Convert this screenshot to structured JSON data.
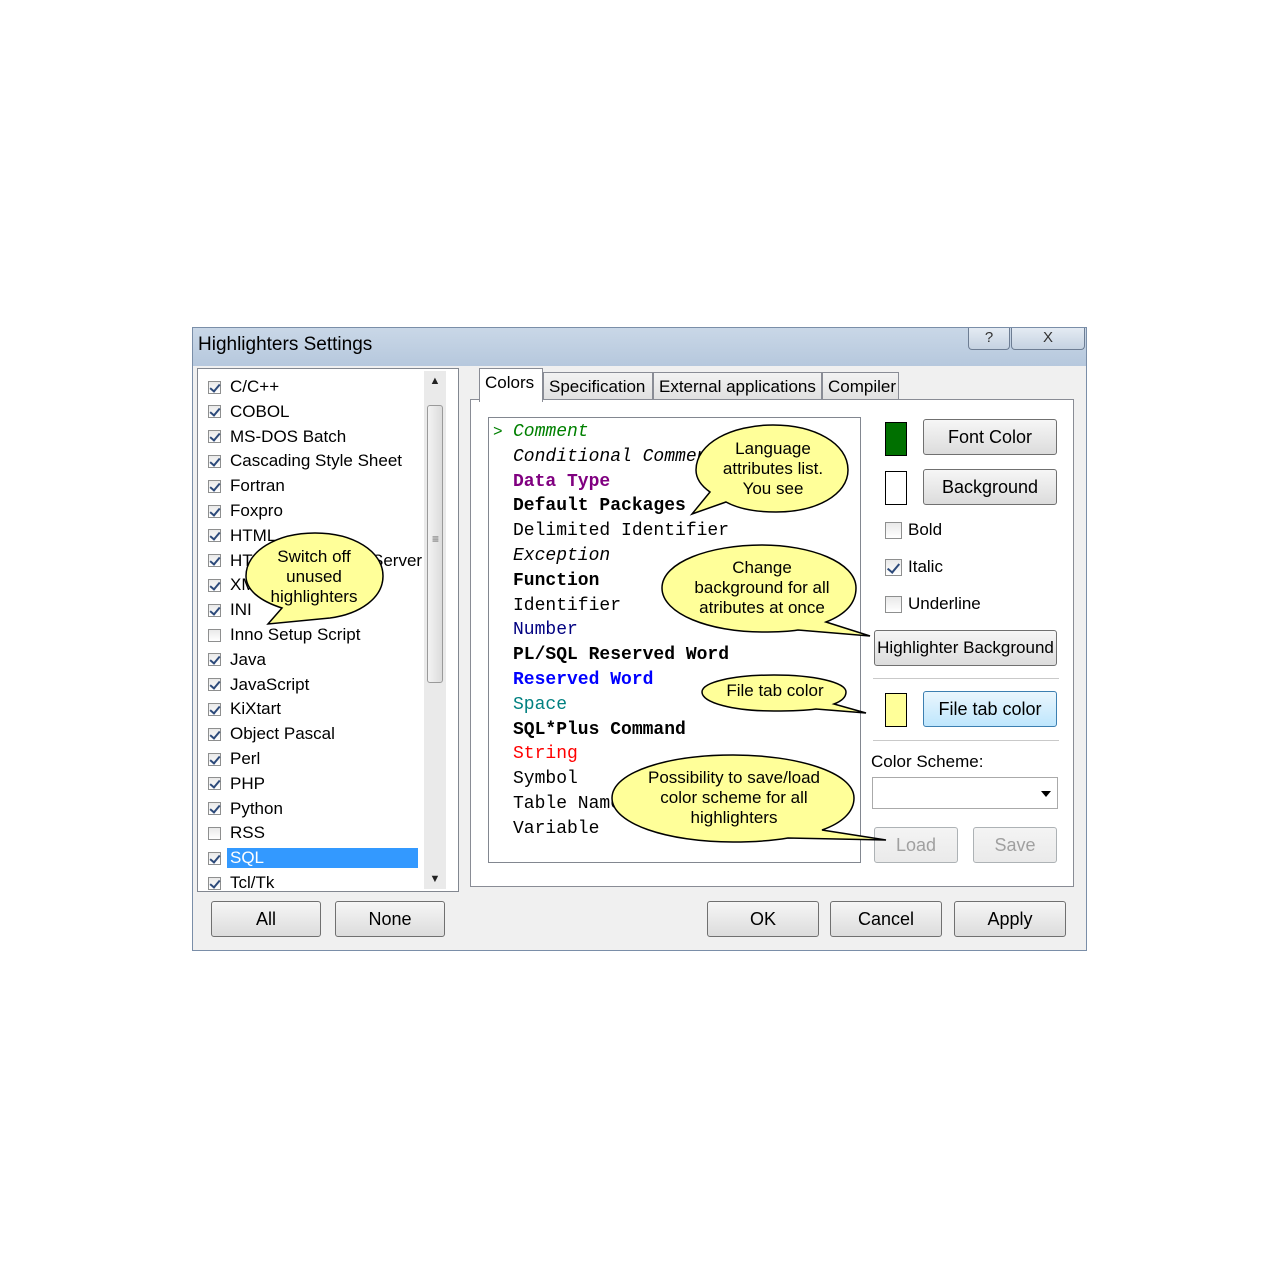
{
  "window": {
    "title": "Highlighters Settings",
    "help_label": "?",
    "close_label": "X"
  },
  "languages": [
    {
      "label": "C/C++",
      "checked": true
    },
    {
      "label": "COBOL",
      "checked": true
    },
    {
      "label": "MS-DOS Batch",
      "checked": true
    },
    {
      "label": "Cascading Style Sheet",
      "checked": true
    },
    {
      "label": "Fortran",
      "checked": true
    },
    {
      "label": "Foxpro",
      "checked": true
    },
    {
      "label": "HTML",
      "checked": true
    },
    {
      "label": "HTML with Scripts/Server",
      "checked": true
    },
    {
      "label": "XML",
      "checked": true
    },
    {
      "label": "INI",
      "checked": true
    },
    {
      "label": "Inno Setup Script",
      "checked": false
    },
    {
      "label": "Java",
      "checked": true
    },
    {
      "label": "JavaScript",
      "checked": true
    },
    {
      "label": "KiXtart",
      "checked": true
    },
    {
      "label": "Object Pascal",
      "checked": true
    },
    {
      "label": "Perl",
      "checked": true
    },
    {
      "label": "PHP",
      "checked": true
    },
    {
      "label": "Python",
      "checked": true
    },
    {
      "label": "RSS",
      "checked": false
    },
    {
      "label": "SQL",
      "checked": true,
      "selected": true
    },
    {
      "label": "Tcl/Tk",
      "checked": true
    }
  ],
  "list_buttons": {
    "all": "All",
    "none": "None"
  },
  "tabs": [
    {
      "label": "Colors",
      "active": true
    },
    {
      "label": "Specification",
      "active": false
    },
    {
      "label": "External applications",
      "active": false
    },
    {
      "label": "Compiler",
      "active": false
    }
  ],
  "attributes": {
    "current_marker": ">",
    "items": [
      {
        "label": "Comment",
        "color": "#008000",
        "style": "italic"
      },
      {
        "label": "Conditional Comment",
        "color": "#000000",
        "style": "italic"
      },
      {
        "label": "Data Type",
        "color": "#800080",
        "style": "bold"
      },
      {
        "label": "Default Packages",
        "color": "#000000",
        "style": "bold"
      },
      {
        "label": "Delimited Identifier",
        "color": "#000000",
        "style": "normal"
      },
      {
        "label": "Exception",
        "color": "#000000",
        "style": "italic"
      },
      {
        "label": "Function",
        "color": "#000000",
        "style": "bold"
      },
      {
        "label": "Identifier",
        "color": "#000000",
        "style": "normal"
      },
      {
        "label": "Number",
        "color": "#000080",
        "style": "normal"
      },
      {
        "label": "PL/SQL Reserved Word",
        "color": "#000000",
        "style": "bold"
      },
      {
        "label": "Reserved Word",
        "color": "#0000ff",
        "style": "bold"
      },
      {
        "label": "Space",
        "color": "#008080",
        "style": "normal"
      },
      {
        "label": "SQL*Plus Command",
        "color": "#000000",
        "style": "bold"
      },
      {
        "label": "String",
        "color": "#ff0000",
        "style": "normal"
      },
      {
        "label": "Symbol",
        "color": "#000000",
        "style": "normal"
      },
      {
        "label": "Table Name",
        "color": "#000000",
        "style": "normal"
      },
      {
        "label": "Variable",
        "color": "#000000",
        "style": "normal"
      }
    ]
  },
  "colors_panel": {
    "font_color_button": "Font Color",
    "font_color": "#007000",
    "background_button": "Background",
    "background_color": "#ffffff",
    "bold": {
      "label": "Bold",
      "checked": false
    },
    "italic": {
      "label": "Italic",
      "checked": true
    },
    "underline": {
      "label": "Underline",
      "checked": false
    },
    "highlighter_background_button": "Highlighter Background",
    "file_tab_color_button": "File tab color",
    "file_tab_color": "#ffff99",
    "color_scheme_label": "Color Scheme:",
    "color_scheme_value": "",
    "load_button": "Load",
    "save_button": "Save"
  },
  "dialog_buttons": {
    "ok": "OK",
    "cancel": "Cancel",
    "apply": "Apply"
  },
  "callouts": {
    "fill_color": "#ffff99",
    "switch_off": [
      "Switch off",
      "unused",
      "highlighters"
    ],
    "language_attributes": [
      "Language",
      "attributes list.",
      "You see"
    ],
    "change_background": [
      "Change",
      "background for all",
      "atributes at once"
    ],
    "file_tab": [
      "File tab color"
    ],
    "save_load": [
      "Possibility to save/load",
      "color scheme for all",
      "highlighters"
    ]
  }
}
